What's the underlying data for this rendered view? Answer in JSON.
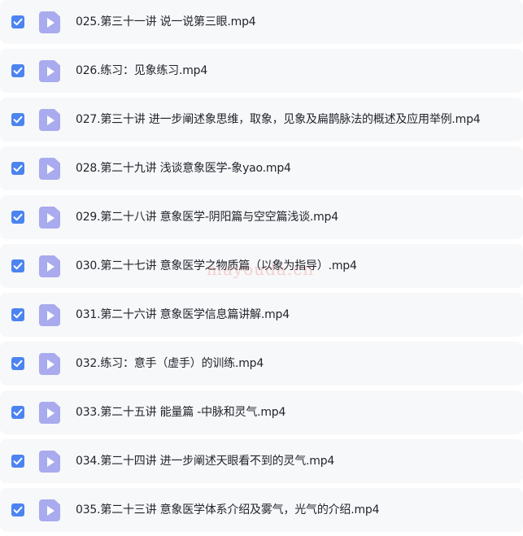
{
  "colors": {
    "row_background": "#f7f8fa",
    "checkbox_checked": "#4c84f0",
    "file_icon": "#a9abee",
    "text": "#1f2329"
  },
  "watermark": "mayouda.cn",
  "files": [
    {
      "name": "025.第三十一讲 说一说第三眼.mp4",
      "checked": true,
      "icon": "video-file-icon"
    },
    {
      "name": "026.练习：见象练习.mp4",
      "checked": true,
      "icon": "video-file-icon"
    },
    {
      "name": "027.第三十讲 进一步阐述象思维，取象，见象及扁鹊脉法的概述及应用举例.mp4",
      "checked": true,
      "icon": "video-file-icon"
    },
    {
      "name": "028.第二十九讲 浅谈意象医学-象yao.mp4",
      "checked": true,
      "icon": "video-file-icon"
    },
    {
      "name": "029.第二十八讲 意象医学-阴阳篇与空空篇浅谈.mp4",
      "checked": true,
      "icon": "video-file-icon"
    },
    {
      "name": "030.第二十七讲 意象医学之物质篇（以象为指导）.mp4",
      "checked": true,
      "icon": "video-file-icon"
    },
    {
      "name": "031.第二十六讲 意象医学信息篇讲解.mp4",
      "checked": true,
      "icon": "video-file-icon"
    },
    {
      "name": "032.练习：意手（虚手）的训练.mp4",
      "checked": true,
      "icon": "video-file-icon"
    },
    {
      "name": "033.第二十五讲 能量篇 -中脉和灵气.mp4",
      "checked": true,
      "icon": "video-file-icon"
    },
    {
      "name": "034.第二十四讲 进一步阐述天眼看不到的灵气.mp4",
      "checked": true,
      "icon": "video-file-icon"
    },
    {
      "name": "035.第二十三讲 意象医学体系介绍及雾气，光气的介绍.mp4",
      "checked": true,
      "icon": "video-file-icon"
    }
  ]
}
